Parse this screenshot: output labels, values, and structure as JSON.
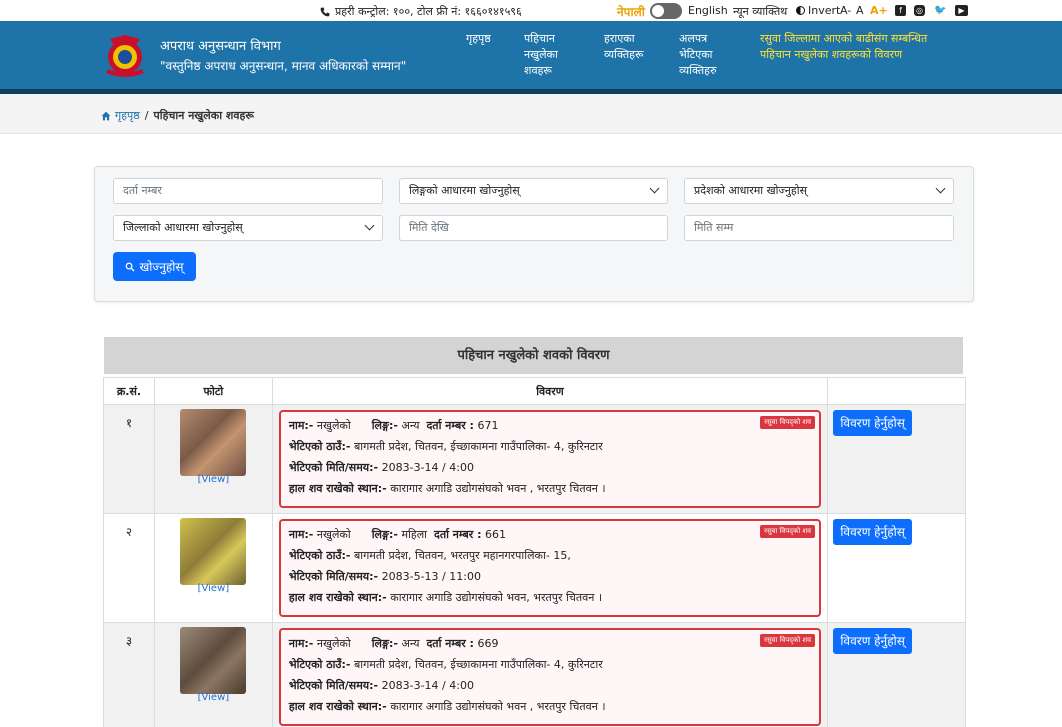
{
  "topbar": {
    "hotline": "प्रहरी कन्ट्रोल: १००, टोल फ्री नं: १६६०१४१५९६",
    "lang_nepali": "नेपाली",
    "lang_english": "English",
    "accessibility": "न्यून व्याक्तिथ",
    "invert": "Invert",
    "font_minus": "A-",
    "font_normal": "A",
    "font_plus": "A+",
    "social_icons": [
      "facebook-icon",
      "instagram-icon",
      "twitter-icon",
      "youtube-icon"
    ]
  },
  "header": {
    "org_name": "अपराध अनुसन्धान विभाग",
    "motto": "\"वस्तुनिष्ठ अपराध अनुसन्धान, मानव अधिकारको सम्मान\"",
    "nav": [
      {
        "label": "गृहपृष्ठ"
      },
      {
        "label": "पहिचान नखुलेका शवहरू"
      },
      {
        "label": "हराएका व्यक्तिहरू"
      },
      {
        "label": "अलपत्र भेटिएका व्यक्तिहरु"
      },
      {
        "label": "रसुवा जिल्लामा आएको बाढीसंग सम्बन्धित पहिचान नखुलेका शवहरूको विवरण"
      }
    ]
  },
  "breadcrumb": {
    "home": "गृहपृष्ठ",
    "separator": "/",
    "current": "पहिचान नखुलेका शवहरू"
  },
  "search": {
    "reg_no_placeholder": "दर्ता नम्बर",
    "gender_select": "लिङ्गको आधारमा खोज्नुहोस्",
    "province_select": "प्रदेशको आधारमा खोज्नुहोस्",
    "district_select": "जिल्लाको आधारमा खोज्नुहोस्",
    "date_from_placeholder": "मिति देखि",
    "date_to_placeholder": "मिति सम्म",
    "button_label": "खोज्नुहोस्"
  },
  "table": {
    "title": "पहिचान नखुलेको शवको विवरण",
    "columns": [
      "क्र.सं.",
      "फोटो",
      "विवरण",
      ""
    ],
    "labels": {
      "name": "नाम:-",
      "gender": "लिङ्ग:-",
      "reg_no": "दर्ता नम्बर :",
      "found_place": "भेटिएको ठाउँ:-",
      "found_date": "भेटिएको मिति/समय:-",
      "body_location": "हाल शव राखेको स्थान:-",
      "view": "[View]",
      "detail_button": "विवरण हेर्नुहोस्"
    },
    "rows": [
      {
        "sn": "१",
        "name": "नखुलेको",
        "gender": "अन्य",
        "reg_no": "671",
        "tag": "रसुवा विपद्को शव",
        "found_place": "बागमती प्रदेश, चितवन, ईच्छाकामना गाउँपालिका- 4, कुरिनटार",
        "found_date": "2083-3-14 / 4:00",
        "body_location": "कारागार अगाडि उद्योगसंघको भवन , भरतपुर चितवन ।",
        "photo_color": "#8a6a55"
      },
      {
        "sn": "२",
        "name": "नखुलेको",
        "gender": "महिला",
        "reg_no": "661",
        "tag": "रसुवा विपद्को शव",
        "found_place": "बागमती प्रदेश, चितवन, भरतपुर महानगरपालिका- 15,",
        "found_date": "2083-5-13 / 11:00",
        "body_location": "कारागार अगाडि उद्योगसंघको भवन, भरतपुर चितवन ।",
        "photo_color": "#9a8a3a"
      },
      {
        "sn": "३",
        "name": "नखुलेको",
        "gender": "अन्य",
        "reg_no": "669",
        "tag": "रसुवा विपद्को शव",
        "found_place": "बागमती प्रदेश, चितवन, ईच्छाकामना गाउँपालिका- 4, कुरिनटार",
        "found_date": "2083-3-14 / 4:00",
        "body_location": "कारागार अगाडि उद्योगसंघको भवन , भरतपुर चितवन ।",
        "photo_color": "#6e5a48"
      }
    ]
  },
  "colors": {
    "header_bg": "#1e74a8",
    "nav_highlight": "#ffe033",
    "primary_button": "#0d6efd",
    "detail_border": "#d9363e"
  }
}
